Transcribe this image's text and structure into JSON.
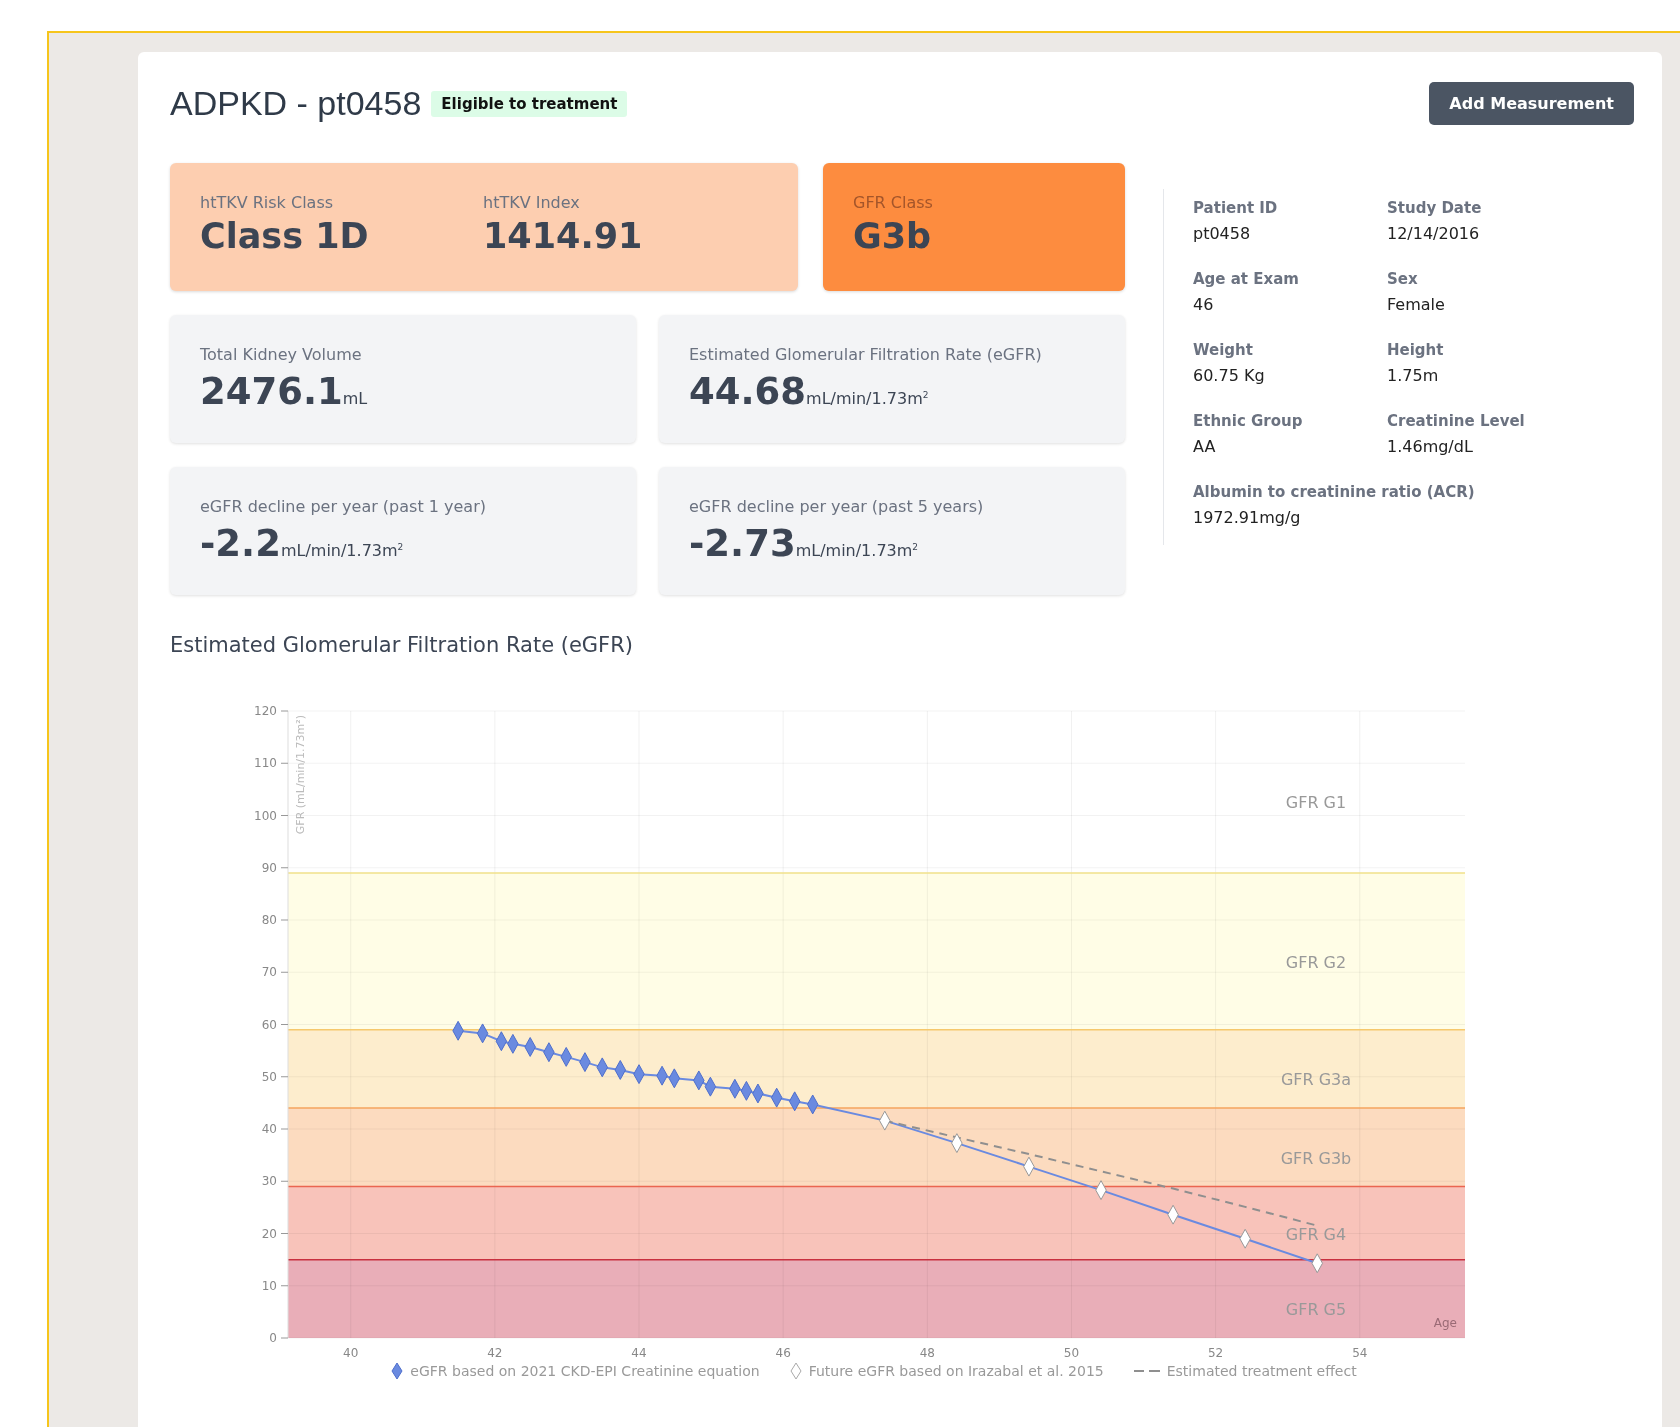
{
  "header": {
    "title": "ADPKD - pt0458",
    "badge": "Eligible to treatment",
    "button": "Add Measurement"
  },
  "class_tiles": [
    {
      "kind": "risk",
      "items": [
        {
          "label": "htTKV Risk Class",
          "value": "Class 1D"
        },
        {
          "label": "htTKV Index",
          "value": "1414.91"
        }
      ]
    },
    {
      "kind": "gfr",
      "items": [
        {
          "label": "GFR Class",
          "value": "G3b"
        }
      ]
    }
  ],
  "metrics": [
    {
      "label": "Total Kidney Volume",
      "value": "2476.1",
      "unit": "mL"
    },
    {
      "label": "Estimated Glomerular Filtration Rate (eGFR)",
      "value": "44.68",
      "unit": "mL/min/1.73m$^{2}$"
    },
    {
      "label": "eGFR decline per year (past 1 year)",
      "value": "-2.2",
      "unit": "mL/min/1.73m$^{2}$"
    },
    {
      "label": "eGFR decline per year (past 5 years)",
      "value": "-2.73",
      "unit": "mL/min/1.73m$^{2}$"
    }
  ],
  "patient": [
    {
      "label": "Patient ID",
      "value": "pt0458"
    },
    {
      "label": "Study Date",
      "value": "12/14/2016"
    },
    {
      "label": "Age at Exam",
      "value": "46"
    },
    {
      "label": "Sex",
      "value": "Female"
    },
    {
      "label": "Weight",
      "value": "60.75 Kg"
    },
    {
      "label": "Height",
      "value": "1.75m"
    },
    {
      "label": "Ethnic Group",
      "value": "AA"
    },
    {
      "label": "Creatinine Level",
      "value": "1.46mg/dL"
    },
    {
      "label": "Albumin to creatinine ratio (ACR)",
      "value": "1972.91mg/g"
    }
  ],
  "chart": {
    "title": "Estimated Glomerular Filtration Rate (eGFR)",
    "chart_data": {
      "type": "line",
      "xlabel": "Age",
      "ylabel": "GFR (mL/min/1.73m²)",
      "xlim": [
        39.13,
        55.46
      ],
      "ylim": [
        0,
        120
      ],
      "xticks": [
        40,
        42,
        44,
        46,
        48,
        50,
        52,
        54
      ],
      "yticks": [
        0,
        10,
        20,
        30,
        40,
        50,
        60,
        70,
        80,
        90,
        100,
        110,
        120
      ],
      "grid": true,
      "series": [
        {
          "name": "eGFR based on 2021 CKD-EPI Creatinine equation",
          "marker": "diamond",
          "line_style": "solid",
          "color": "#6a8ae0",
          "x": [
            41.49,
            41.83,
            42.09,
            42.25,
            42.49,
            42.75,
            42.99,
            43.25,
            43.49,
            43.74,
            44.0,
            44.32,
            44.49,
            44.83,
            44.99,
            45.33,
            45.49,
            45.65,
            45.91,
            46.16,
            46.41
          ],
          "values": [
            58.8,
            58.3,
            56.8,
            56.3,
            55.7,
            54.7,
            53.8,
            52.8,
            51.8,
            51.3,
            50.5,
            50.2,
            49.7,
            49.3,
            48.1,
            47.7,
            47.3,
            46.8,
            46.0,
            45.3,
            44.7
          ]
        },
        {
          "name": "Future eGFR based on Irazabal et al. 2015",
          "marker": "diamond",
          "line_style": "solid",
          "color": "#ffffff",
          "x": [
            46.41,
            47.41,
            48.41,
            49.41,
            50.41,
            51.41,
            52.41,
            53.41
          ],
          "values": [
            44.7,
            41.6,
            37.3,
            32.8,
            28.3,
            23.6,
            19.0,
            14.3
          ]
        },
        {
          "name": "Estimated treatment effect",
          "marker": "none",
          "line_style": "dashed",
          "color": "#8f8f8f",
          "x": [
            47.41,
            48.41,
            49.41,
            50.41,
            51.41,
            52.41,
            53.41
          ],
          "values": [
            41.6,
            38.4,
            35.2,
            31.9,
            28.6,
            25.1,
            21.5
          ]
        }
      ],
      "bands": [
        {
          "axis": "y",
          "from": 59,
          "to": 89,
          "color": "#fffde6"
        },
        {
          "axis": "y",
          "from": 44,
          "to": 59,
          "color": "#fdedcd"
        },
        {
          "axis": "y",
          "from": 29,
          "to": 44,
          "color": "#fcdbbf"
        },
        {
          "axis": "y",
          "from": 15,
          "to": 29,
          "color": "#f8c3ba"
        },
        {
          "axis": "y",
          "from": 0,
          "to": 15,
          "color": "#e9aeb8"
        }
      ],
      "ref_lines": [
        {
          "axis": "y",
          "value": 89,
          "color": "#f0e08a"
        },
        {
          "axis": "y",
          "value": 59,
          "color": "#f6c86c"
        },
        {
          "axis": "y",
          "value": 44,
          "color": "#f4a35c"
        },
        {
          "axis": "y",
          "value": 29,
          "color": "#ea6550"
        },
        {
          "axis": "y",
          "value": 15,
          "color": "#c8303f"
        }
      ],
      "annotations": [
        "GFR G1",
        "GFR G2",
        "GFR G3a",
        "GFR G3b",
        "GFR G4",
        "GFR G5"
      ]
    }
  }
}
